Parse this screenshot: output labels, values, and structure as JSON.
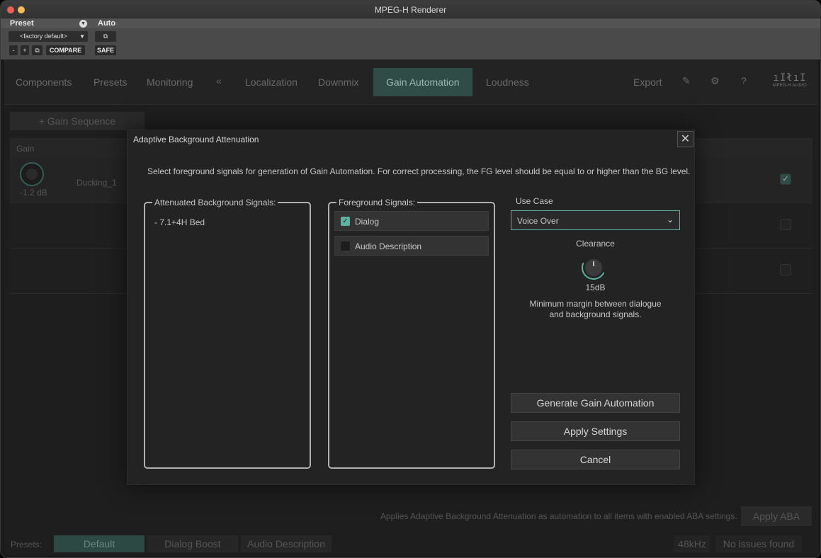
{
  "window": {
    "title": "MPEG-H Renderer"
  },
  "host": {
    "preset_label": "Preset",
    "auto_label": "Auto",
    "preset_value": "<factory default>",
    "minus": "-",
    "plus": "+",
    "compare": "COMPARE",
    "safe": "SAFE"
  },
  "nav": {
    "items": [
      "Components",
      "Presets",
      "Monitoring",
      "Localization",
      "Downmix",
      "Gain Automation",
      "Loudness"
    ],
    "collapse_icon": "«",
    "export": "Export",
    "logo_text": "MPEG-H AUDIO"
  },
  "background": {
    "gain_sequence_button": "+ Gain Sequence",
    "table_header": "Gain",
    "row_gain": "-1.2 dB",
    "row_name": "Ducking_1",
    "aba_info": "Applies Adaptive Background Attenuation as automation to all items with enabled ABA settings.",
    "apply_aba": "Apply ABA",
    "footer_label": "Presets:",
    "footer_presets": [
      "Default",
      "Dialog Boost",
      "Audio Description"
    ],
    "sample_rate": "48kHz",
    "status": "No issues found"
  },
  "modal": {
    "title": "Adaptive Background Attenuation",
    "close": "✕",
    "description": "Select foreground signals for generation of Gain Automation. For correct processing, the FG level should be equal to or higher than the BG level.",
    "bg_panel_title": "Attenuated Background Signals:",
    "bg_items": [
      "- 7.1+4H Bed"
    ],
    "fg_panel_title": "Foreground Signals:",
    "fg_items": [
      {
        "label": "Dialog",
        "checked": true
      },
      {
        "label": "Audio Description",
        "checked": false
      }
    ],
    "use_case_label": "Use Case",
    "use_case_value": "Voice Over",
    "clearance_label": "Clearance",
    "clearance_value": "15dB",
    "clearance_desc_1": "Minimum margin between dialogue",
    "clearance_desc_2": "and background signals.",
    "generate_button": "Generate Gain Automation",
    "apply_button": "Apply Settings",
    "cancel_button": "Cancel"
  },
  "colors": {
    "accent": "#5db39f",
    "active_tab": "#2f4d46"
  }
}
